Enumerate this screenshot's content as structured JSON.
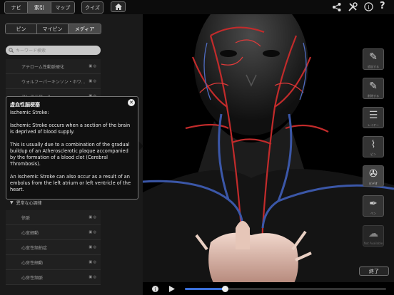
{
  "topbar": {
    "tabs": [
      "ナビ",
      "索引",
      "マップ"
    ],
    "selected_tab": "索引",
    "quiz_label": "クイズ",
    "home_icon": "home-icon",
    "share_icon": "share-icon",
    "tools_icon": "tools-icon",
    "info_icon": "info-icon",
    "help_icon": "help-icon"
  },
  "subtabs": [
    "ピン",
    "マイピン",
    "メディア"
  ],
  "selected_subtab": "メディア",
  "search": {
    "placeholder": "キーワード検索"
  },
  "list_top": [
    {
      "label": "アテローム性動脈硬化"
    },
    {
      "label": "ウォルフーパーキンソン・ホワ..."
    },
    {
      "label": "コレステロール"
    }
  ],
  "list_bottom_header": "異常な心調律",
  "list_bottom": [
    {
      "label": "徐脈"
    },
    {
      "label": "心室細動"
    },
    {
      "label": "心室性頻拍症"
    },
    {
      "label": "心房性細動"
    },
    {
      "label": "心房性頻脈"
    }
  ],
  "popup": {
    "title": "虚血性脳梗塞",
    "p1": "Ischemic Stroke:",
    "p2": "Ischemic Stroke occurs when a section of the brain is deprived of blood supply.",
    "p3": "This is usually due to a combination of the gradual buildup of an Atherosclerotic plaque accompanied by the formation of a blood clot (Cerebral Thrombosis).",
    "p4": "An Ischemic Stroke can also occur as a result of an embolus from the left atrium or left ventricle of the heart."
  },
  "tools": [
    {
      "label": "追加する",
      "icon": "pin-add-icon"
    },
    {
      "label": "削除する",
      "icon": "pin-remove-icon"
    },
    {
      "label": "レイヤー",
      "icon": "layers-icon"
    },
    {
      "label": "ピン",
      "icon": "pin-icon"
    },
    {
      "label": "ビデオ",
      "icon": "film-reel-icon"
    },
    {
      "label": "ペン",
      "icon": "pen-icon"
    },
    {
      "label": "Not Available",
      "icon": "brain-icon"
    }
  ],
  "end_label": "終了",
  "playback": {
    "progress": 0.2
  }
}
